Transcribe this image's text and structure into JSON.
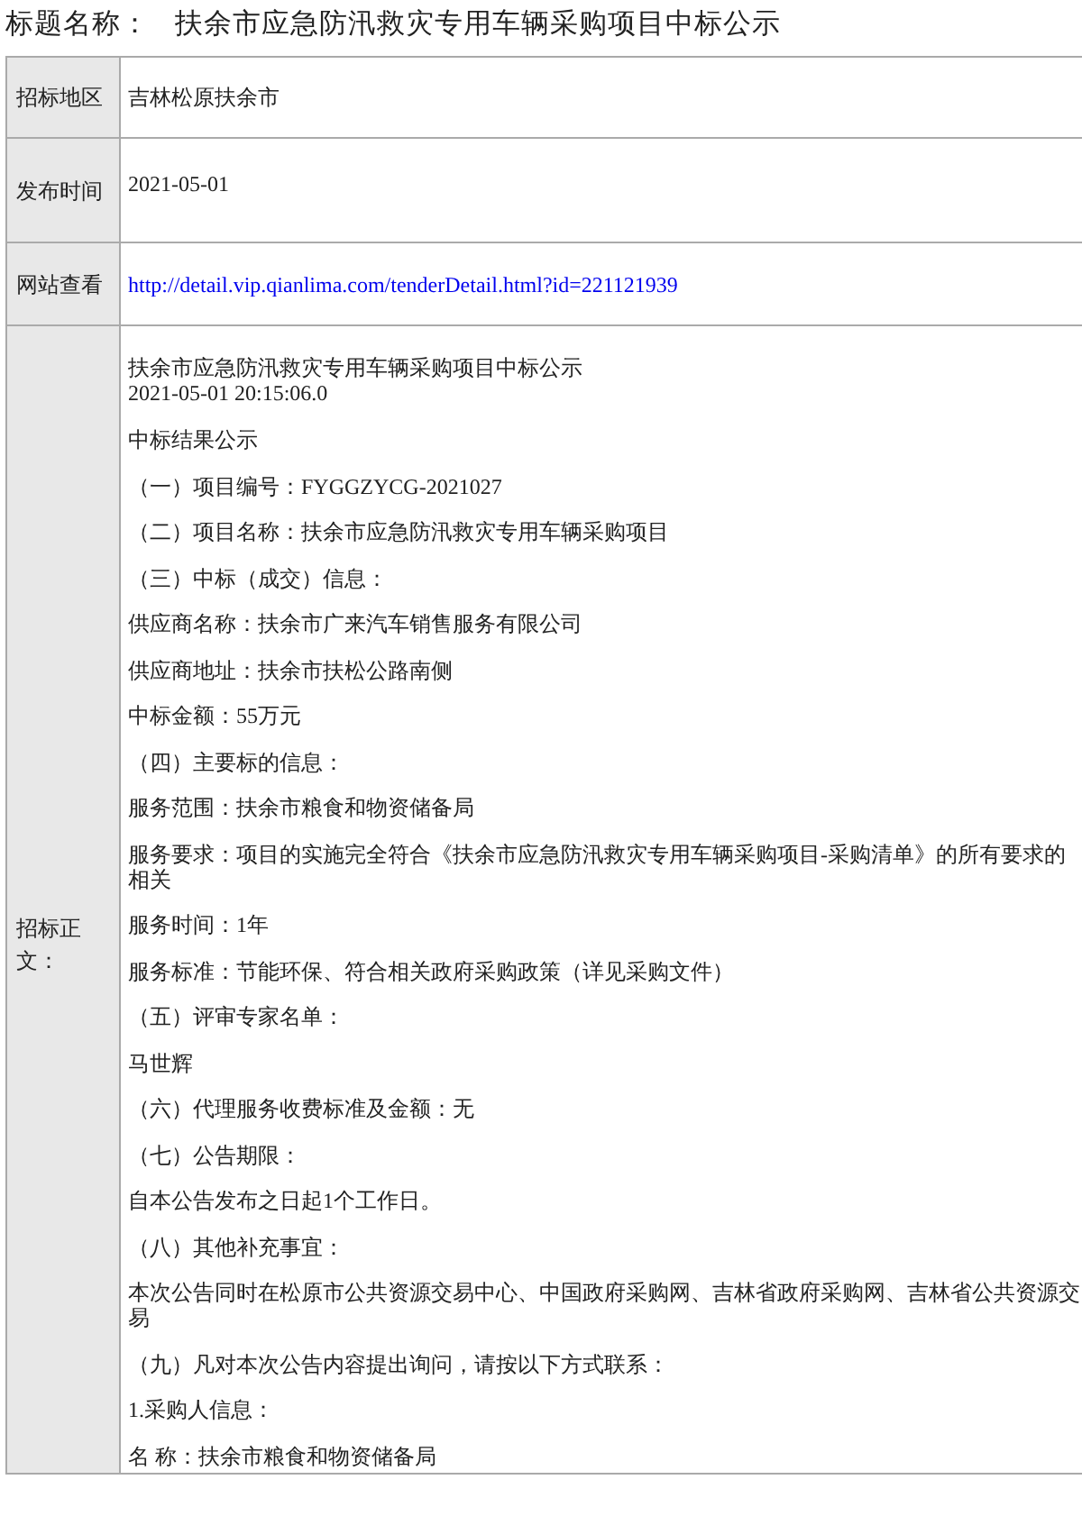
{
  "title": {
    "label": "标题名称：",
    "value": "扶余市应急防汛救灾专用车辆采购项目中标公示"
  },
  "table": {
    "rows": [
      {
        "kind": "text",
        "label": "招标地区",
        "value": "吉林松原扶余市"
      },
      {
        "kind": "date",
        "label": "发布时间",
        "value": "2021-05-01"
      },
      {
        "kind": "link",
        "label": "网站查看",
        "value": "http://detail.vip.qianlima.com/tenderDetail.html?id=221121939"
      },
      {
        "kind": "body",
        "label": "招标正文：",
        "header_lines": [
          "扶余市应急防汛救灾专用车辆采购项目中标公示",
          "2021-05-01 20:15:06.0"
        ],
        "paragraphs": [
          "中标结果公示",
          "（一）项目编号：FYGGZYCG-2021027",
          "（二）项目名称：扶余市应急防汛救灾专用车辆采购项目",
          "（三）中标（成交）信息：",
          "供应商名称：扶余市广来汽车销售服务有限公司",
          "供应商地址：扶余市扶松公路南侧",
          "中标金额：55万元",
          "（四）主要标的信息：",
          "服务范围：扶余市粮食和物资储备局",
          "服务要求：项目的实施完全符合《扶余市应急防汛救灾专用车辆采购项目-采购清单》的所有要求的相关",
          "服务时间：1年",
          "服务标准：节能环保、符合相关政府采购政策（详见采购文件）",
          "（五）评审专家名单：",
          "马世辉",
          "（六）代理服务收费标准及金额：无",
          "（七）公告期限：",
          "自本公告发布之日起1个工作日。",
          "（八）其他补充事宜：",
          "本次公告同时在松原市公共资源交易中心、中国政府采购网、吉林省政府采购网、吉林省公共资源交易",
          "（九）凡对本次公告内容提出询问，请按以下方式联系：",
          "1.采购人信息：",
          "名 称：扶余市粮食和物资储备局"
        ]
      }
    ]
  }
}
